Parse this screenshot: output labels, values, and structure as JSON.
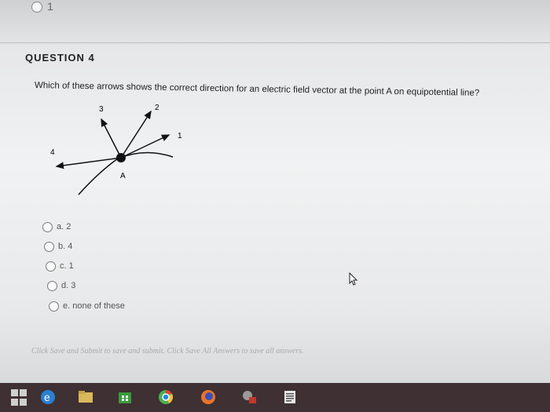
{
  "previous": {
    "label": "1"
  },
  "question": {
    "title": "QUESTION 4",
    "text": "Which of these arrows shows the correct direction for an electric field vector at the point A on equipotential line?"
  },
  "figure": {
    "labels": {
      "arrow1": "1",
      "arrow2": "2",
      "arrow3": "3",
      "arrow4": "4",
      "point": "A"
    }
  },
  "options": [
    {
      "label": "a. 2"
    },
    {
      "label": "b. 4"
    },
    {
      "label": "c. 1"
    },
    {
      "label": "d. 3"
    },
    {
      "label": "e. none of these"
    }
  ],
  "footer": {
    "text": "Click Save and Submit to save and submit. Click Save All Answers to save all answers."
  },
  "taskbar": {
    "icons": [
      "windows-start-icon",
      "edge-icon",
      "file-explorer-icon",
      "store-icon",
      "chrome-icon",
      "firefox-icon",
      "app-icon",
      "notes-icon"
    ]
  }
}
